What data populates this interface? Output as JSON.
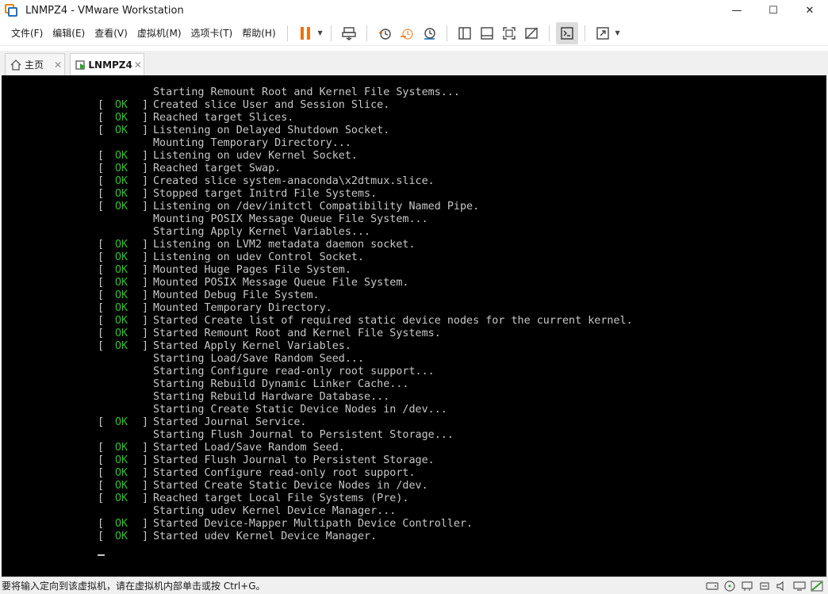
{
  "window": {
    "title": "LNMPZ4 - VMware Workstation",
    "minimize_glyph": "—",
    "maximize_glyph": "☐",
    "close_glyph": "✕"
  },
  "menu": [
    "文件(F)",
    "编辑(E)",
    "查看(V)",
    "虚拟机(M)",
    "选项卡(T)",
    "帮助(H)"
  ],
  "tabs": {
    "home": {
      "label": "主页",
      "close": "✕",
      "icon": "home-icon"
    },
    "vm": {
      "label": "LNMPZ4",
      "close": "✕",
      "icon": "vm-running-icon"
    }
  },
  "console": {
    "ok_text": "OK",
    "bracket_open": "[",
    "bracket_close": "]",
    "lines": [
      {
        "ok": false,
        "text": "Starting Remount Root and Kernel File Systems..."
      },
      {
        "ok": true,
        "text": "Created slice User and Session Slice."
      },
      {
        "ok": true,
        "text": "Reached target Slices."
      },
      {
        "ok": true,
        "text": "Listening on Delayed Shutdown Socket."
      },
      {
        "ok": false,
        "text": "Mounting Temporary Directory..."
      },
      {
        "ok": true,
        "text": "Listening on udev Kernel Socket."
      },
      {
        "ok": true,
        "text": "Reached target Swap."
      },
      {
        "ok": true,
        "text": "Created slice system-anaconda\\x2dtmux.slice."
      },
      {
        "ok": true,
        "text": "Stopped target Initrd File Systems."
      },
      {
        "ok": true,
        "text": "Listening on /dev/initctl Compatibility Named Pipe."
      },
      {
        "ok": false,
        "text": "Mounting POSIX Message Queue File System..."
      },
      {
        "ok": false,
        "text": "Starting Apply Kernel Variables..."
      },
      {
        "ok": true,
        "text": "Listening on LVM2 metadata daemon socket."
      },
      {
        "ok": true,
        "text": "Listening on udev Control Socket."
      },
      {
        "ok": true,
        "text": "Mounted Huge Pages File System."
      },
      {
        "ok": true,
        "text": "Mounted POSIX Message Queue File System."
      },
      {
        "ok": true,
        "text": "Mounted Debug File System."
      },
      {
        "ok": true,
        "text": "Mounted Temporary Directory."
      },
      {
        "ok": true,
        "text": "Started Create list of required static device nodes for the current kernel."
      },
      {
        "ok": true,
        "text": "Started Remount Root and Kernel File Systems."
      },
      {
        "ok": true,
        "text": "Started Apply Kernel Variables."
      },
      {
        "ok": false,
        "text": "Starting Load/Save Random Seed..."
      },
      {
        "ok": false,
        "text": "Starting Configure read-only root support..."
      },
      {
        "ok": false,
        "text": "Starting Rebuild Dynamic Linker Cache..."
      },
      {
        "ok": false,
        "text": "Starting Rebuild Hardware Database..."
      },
      {
        "ok": false,
        "text": "Starting Create Static Device Nodes in /dev..."
      },
      {
        "ok": true,
        "text": "Started Journal Service."
      },
      {
        "ok": false,
        "text": "Starting Flush Journal to Persistent Storage..."
      },
      {
        "ok": true,
        "text": "Started Load/Save Random Seed."
      },
      {
        "ok": true,
        "text": "Started Flush Journal to Persistent Storage."
      },
      {
        "ok": true,
        "text": "Started Configure read-only root support."
      },
      {
        "ok": true,
        "text": "Started Create Static Device Nodes in /dev."
      },
      {
        "ok": true,
        "text": "Reached target Local File Systems (Pre)."
      },
      {
        "ok": false,
        "text": "Starting udev Kernel Device Manager..."
      },
      {
        "ok": true,
        "text": "Started Device-Mapper Multipath Device Controller."
      },
      {
        "ok": true,
        "text": "Started udev Kernel Device Manager."
      }
    ]
  },
  "status": {
    "text": "要将输入定向到该虚拟机，请在虚拟机内部单击或按 Ctrl+G。"
  },
  "colors": {
    "console_bg": "#000000",
    "console_text": "#c8c8c8",
    "ok_green": "#2fbf2f",
    "pause_orange": "#e8731a"
  }
}
